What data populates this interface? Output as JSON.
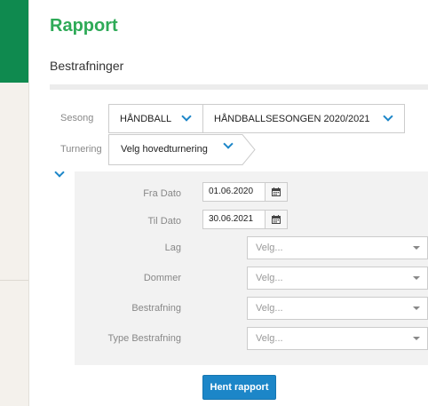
{
  "page": {
    "title": "Rapport",
    "subtitle": "Bestrafninger"
  },
  "selectors": {
    "season_label": "Sesong",
    "sport": "HÅNDBALL",
    "season": "HÅNDBALLSESONGEN 2020/2021",
    "tournament_label": "Turnering",
    "tournament": "Velg hovedturnering"
  },
  "filters": {
    "from_date_label": "Fra Dato",
    "from_date": "01.06.2020",
    "to_date_label": "Til Dato",
    "to_date": "30.06.2021",
    "team_label": "Lag",
    "team_placeholder": "Velg...",
    "referee_label": "Dommer",
    "referee_placeholder": "Velg...",
    "penalty_label": "Bestrafning",
    "penalty_placeholder": "Velg...",
    "penalty_type_label": "Type Bestrafning",
    "penalty_type_placeholder": "Velg..."
  },
  "actions": {
    "fetch_report": "Hent rapport"
  },
  "colors": {
    "sidebar_accent": "#0f8a4f",
    "title": "#2eaa57",
    "primary": "#1c86c8"
  }
}
